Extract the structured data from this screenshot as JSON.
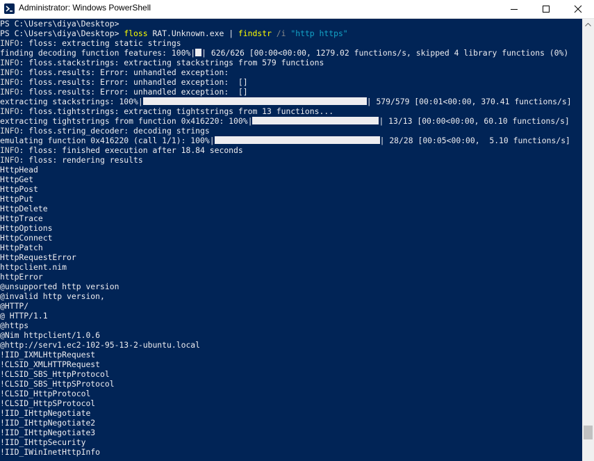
{
  "window": {
    "title": "Administrator: Windows PowerShell",
    "bg_color": "#012456",
    "text_color": "#eeedf0"
  },
  "titlebar": {
    "icon": "powershell-icon",
    "buttons": [
      "minimize-icon",
      "maximize-icon",
      "close-icon"
    ]
  },
  "console": {
    "prompt1": "PS C:\\Users\\diya\\Desktop>",
    "prompt2": "PS C:\\Users\\diya\\Desktop>",
    "command": {
      "exe": "floss",
      "arg": "RAT.Unknown.exe",
      "pipe": "|",
      "filter": "findstr",
      "switch": "/i",
      "pattern": "\"http https\""
    },
    "log1_prefix": "INFO",
    "log1_text": ": floss: extracting static strings",
    "prog1_label": "finding decoding function features: 100%|",
    "prog1_stats": "| 626/626 [00:00<00:00, 1279.02 functions/s, skipped 4 library functions (0%)",
    "log2_prefix": "INFO",
    "log2_text": ": floss.stackstrings: extracting stackstrings from 579 functions",
    "log3_prefix": "INFO",
    "log3_text": ": floss.results: Error: unhandled exception:",
    "log4_prefix": "INFO",
    "log4_text": ": floss.results: Error: unhandled exception:  []",
    "log5_prefix": "INFO",
    "log5_text": ": floss.results: Error: unhandled exception:  []",
    "prog2_label": "extracting stackstrings: 100%|",
    "prog2_stats": "| 579/579 [00:01<00:00, 370.41 functions/s]",
    "log6_prefix": "INFO",
    "log6_text": ": floss.tightstrings: extracting tightstrings from 13 functions...",
    "prog3_label": "extracting tightstrings from function 0x416220: 100%|",
    "prog3_stats": "| 13/13 [00:00<00:00, 60.10 functions/s]",
    "log7_prefix": "INFO",
    "log7_text": ": floss.string_decoder: decoding strings",
    "prog4_label": "emulating function 0x416220 (call 1/1): 100%|",
    "prog4_stats": "| 28/28 [00:05<00:00,  5.10 functions/s]",
    "log8_prefix": "INFO",
    "log8_text": ": floss: finished execution after 18.84 seconds",
    "log9_prefix": "INFO",
    "log9_text": ": floss: rendering results",
    "progress_percent": [
      100,
      100,
      100,
      100
    ],
    "output": [
      "HttpHead",
      "HttpGet",
      "HttpPost",
      "HttpPut",
      "HttpDelete",
      "HttpTrace",
      "HttpOptions",
      "HttpConnect",
      "HttpPatch",
      "HttpRequestError",
      "httpclient.nim",
      "httpError",
      "@unsupported http version",
      "@invalid http version,",
      "@HTTP/",
      "@ HTTP/1.1",
      "@https",
      "@Nim httpclient/1.0.6",
      "@http://serv1.ec2-102-95-13-2-ubuntu.local",
      "!IID_IXMLHttpRequest",
      "!CLSID_XMLHTTPRequest",
      "!CLSID_SBS_HttpProtocol",
      "!CLSID_SBS_HttpSProtocol",
      "!CLSID_HttpProtocol",
      "!CLSID_HttpSProtocol",
      "!IID_IHttpNegotiate",
      "!IID_IHttpNegotiate2",
      "!IID_IHttpNegotiate3",
      "!IID_IHttpSecurity",
      "!IID_IWinInetHttpInfo"
    ]
  }
}
